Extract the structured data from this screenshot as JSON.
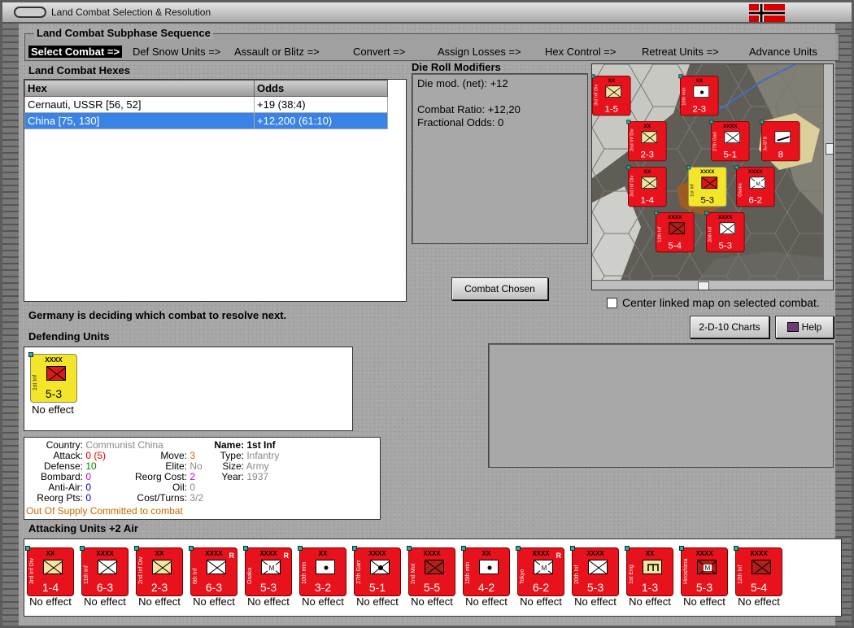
{
  "window": {
    "title": "Land Combat Selection & Resolution",
    "flag_colors": [
      "#000000",
      "#ffffff",
      "#d40000"
    ]
  },
  "sequence": {
    "title": "Land Combat Subphase Sequence",
    "steps": [
      "Select Combat =>",
      "Def Snow Units =>",
      "Assault or Blitz =>",
      "Convert =>",
      "Assign Losses =>",
      "Hex Control =>",
      "Retreat Units =>",
      "Advance Units"
    ]
  },
  "hexes": {
    "title": "Land Combat Hexes",
    "columns": [
      "Hex",
      "Odds"
    ],
    "rows": [
      {
        "hex": "Cernauti, USSR [56, 52]",
        "odds": "+19 (38:4)"
      },
      {
        "hex": "China [75, 130]",
        "odds": "+12,200 (61:10)"
      }
    ],
    "selected_row": 1
  },
  "modifiers": {
    "title": "Die Roll Modifiers",
    "lines": [
      "Die mod. (net): +12",
      "",
      "Combat Ratio: +12,20",
      "Fractional Odds: 0"
    ]
  },
  "combat_chosen_button": "Combat Chosen",
  "center_map_label": "Center linked map on selected combat.",
  "status_text": "Germany is deciding which combat to resolve next.",
  "charts_button": "2-D-10 Charts",
  "help_button": "Help",
  "defending": {
    "title": "Defending Units",
    "unit": {
      "name": "1st Inf",
      "size": "XXXX",
      "strength": "5-3",
      "effect": "No effect"
    }
  },
  "unit_info": {
    "country_label": "Country:",
    "country": "Communist China",
    "attack_label": "Attack:",
    "attack": "0 (5)",
    "defense_label": "Defense:",
    "defense": "10",
    "bombard_label": "Bombard:",
    "bombard": "0",
    "antiair_label": "Anti-Air:",
    "antiair": "0",
    "reorg_pts_label": "Reorg Pts:",
    "reorg_pts": "0",
    "move_label": "Move:",
    "move": "3",
    "elite_label": "Elite:",
    "elite": "No",
    "reorg_cost_label": "Reorg Cost:",
    "reorg_cost": "2",
    "oil_label": "Oil:",
    "oil": "0",
    "cost_turns_label": "Cost/Turns:",
    "cost_turns": "3/2",
    "name_label": "Name:",
    "name": "1st Inf",
    "type_label": "Type:",
    "type": "Infantry",
    "size_label": "Size:",
    "size": "Army",
    "year_label": "Year:",
    "year": "1937",
    "supply_status": "Out Of Supply",
    "commit_status": "Committed to combat"
  },
  "attacking": {
    "title": "Attacking Units +2 Air",
    "units": [
      {
        "name": "3rd Inf Div",
        "size": "XX",
        "strength": "1-4",
        "sym": "beige",
        "effect": "No effect",
        "r": ""
      },
      {
        "name": "11th Inf",
        "size": "XXXX",
        "strength": "6-3",
        "sym": "inf",
        "effect": "No effect",
        "r": ""
      },
      {
        "name": "2nd Inf Div",
        "size": "XX",
        "strength": "2-3",
        "sym": "beige",
        "effect": "No effect",
        "r": ""
      },
      {
        "name": "6th Inf",
        "size": "XXXX",
        "strength": "6-3",
        "sym": "inf",
        "effect": "No effect",
        "r": "R"
      },
      {
        "name": "Osaka",
        "size": "XXXX",
        "strength": "5-3",
        "sym": "mtn",
        "effect": "No effect",
        "r": "R"
      },
      {
        "name": "10th mtn",
        "size": "XX",
        "strength": "3-2",
        "sym": "dot",
        "effect": "No effect",
        "r": ""
      },
      {
        "name": "27th Garr",
        "size": "XXXX",
        "strength": "5-1",
        "sym": "garr",
        "effect": "No effect",
        "r": ""
      },
      {
        "name": "2nd Mot",
        "size": "XXXX",
        "strength": "5-5",
        "sym": "dark",
        "effect": "No effect",
        "r": ""
      },
      {
        "name": "15th mtn",
        "size": "XX",
        "strength": "4-2",
        "sym": "dot",
        "effect": "No effect",
        "r": ""
      },
      {
        "name": "Tokyo",
        "size": "XXXX",
        "strength": "6-2",
        "sym": "mtn",
        "effect": "No effect",
        "r": "R"
      },
      {
        "name": "20th Inf",
        "size": "XXXX",
        "strength": "5-3",
        "sym": "inf",
        "effect": "No effect",
        "r": ""
      },
      {
        "name": "1st Eng",
        "size": "XX",
        "strength": "1-3",
        "sym": "eng",
        "effect": "No effect",
        "r": ""
      },
      {
        "name": "Hiroshima",
        "size": "XXXX",
        "strength": "5-3",
        "sym": "darkm",
        "effect": "No effect",
        "r": ""
      },
      {
        "name": "12th Inf",
        "size": "XXXX",
        "strength": "5-4",
        "sym": "dark",
        "effect": "No effect",
        "r": ""
      }
    ]
  },
  "map_counters": [
    {
      "name": "3rd Inf Div",
      "strength": "1-5",
      "size": "XX",
      "sym": "beige"
    },
    {
      "name": "10th mtn",
      "strength": "2-3",
      "size": "XX",
      "sym": "dot"
    },
    {
      "name": "2nd Inf Div",
      "strength": "2-3",
      "size": "XX",
      "sym": "beige"
    },
    {
      "name": "27th Garr",
      "strength": "5-1",
      "size": "XXXX",
      "sym": "inf"
    },
    {
      "name": "Ju-87B",
      "strength": "8",
      "size": "",
      "sym": "air"
    },
    {
      "name": "3rd Inf Div",
      "strength": "1-4",
      "size": "XX",
      "sym": "beige"
    },
    {
      "name": "1st Inf",
      "strength": "5-3",
      "size": "XXXX",
      "sym": "redbox"
    },
    {
      "name": "Osaka",
      "strength": "6-2",
      "size": "XXXX",
      "sym": "mtn"
    },
    {
      "name": "12th Inf",
      "strength": "5-4",
      "size": "XXXX",
      "sym": "dark"
    },
    {
      "name": "20th Inf",
      "strength": "5-3",
      "size": "XXXX",
      "sym": "inf"
    }
  ]
}
